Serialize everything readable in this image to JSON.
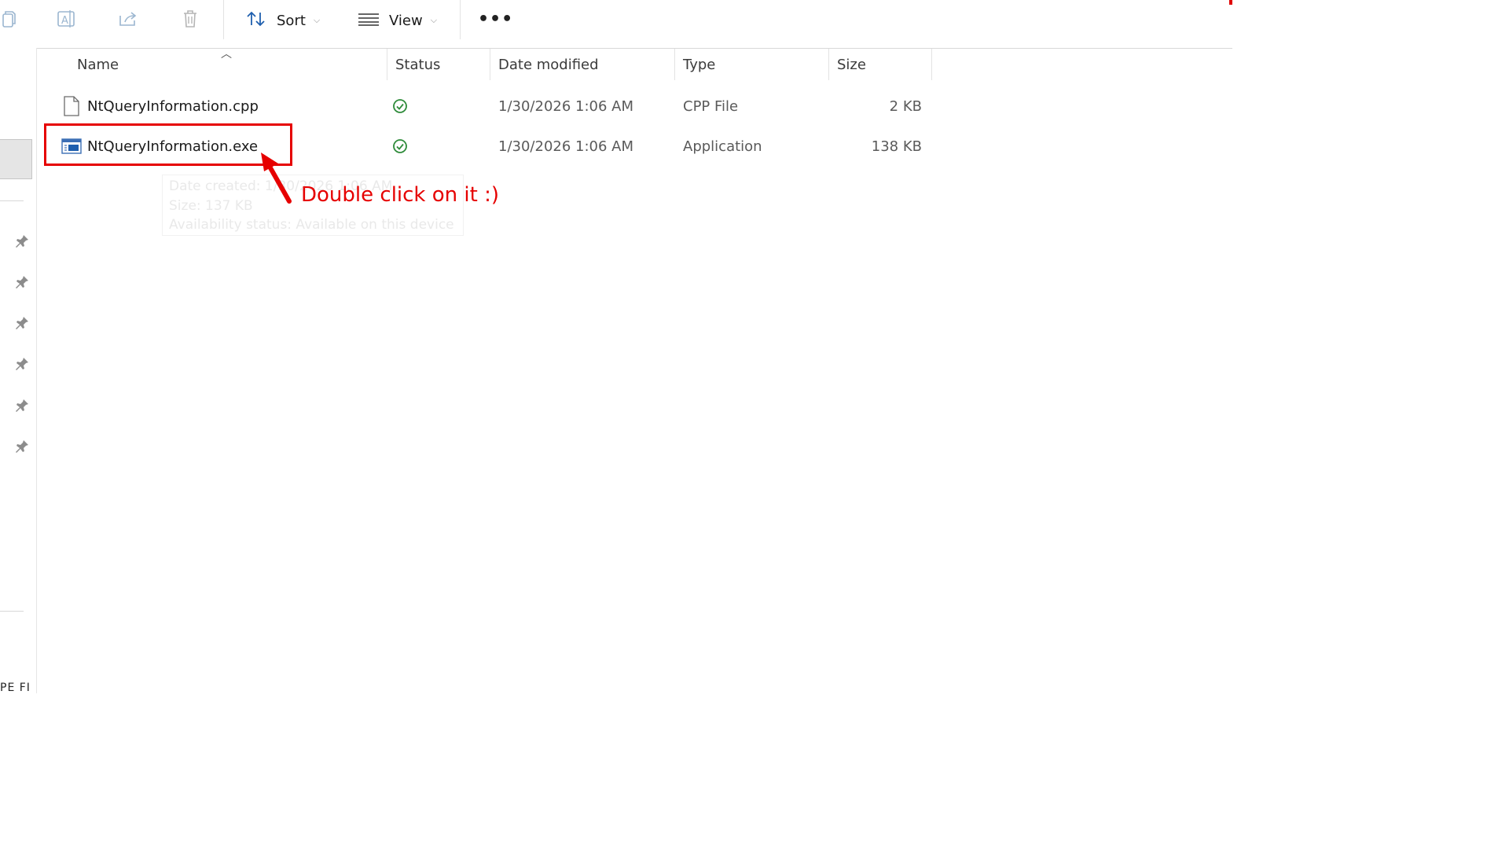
{
  "toolbar": {
    "sort_label": "Sort",
    "view_label": "View",
    "more_label": "•••",
    "icons": [
      "copy-icon",
      "rename-icon",
      "share-icon",
      "delete-icon",
      "sort-icon",
      "view-icon",
      "more-icon"
    ]
  },
  "columns": {
    "name": "Name",
    "status": "Status",
    "date_modified": "Date modified",
    "type": "Type",
    "size": "Size"
  },
  "files": [
    {
      "name": "NtQueryInformation.cpp",
      "status_icon": "synced-check-icon",
      "date_modified": "1/30/2026 1:06 AM",
      "type": "CPP File",
      "size": "2 KB",
      "icon": "document-icon"
    },
    {
      "name": "NtQueryInformation.exe",
      "status_icon": "synced-check-icon",
      "date_modified": "1/30/2026 1:06 AM",
      "type": "Application",
      "size": "138 KB",
      "icon": "application-icon"
    }
  ],
  "tooltip": {
    "line1": "Date created: 1/30/2026 1:06 AM",
    "line2": "Size: 137 KB",
    "line3": "Availability status: Available on this device"
  },
  "annotation": {
    "text": "Double click on it :)",
    "color": "#e60000"
  },
  "nav": {
    "bottom_text": "PE FI"
  },
  "colors": {
    "accent_red": "#e60000",
    "status_green": "#2e8b3a",
    "selection_gray": "#e5e5e5"
  }
}
